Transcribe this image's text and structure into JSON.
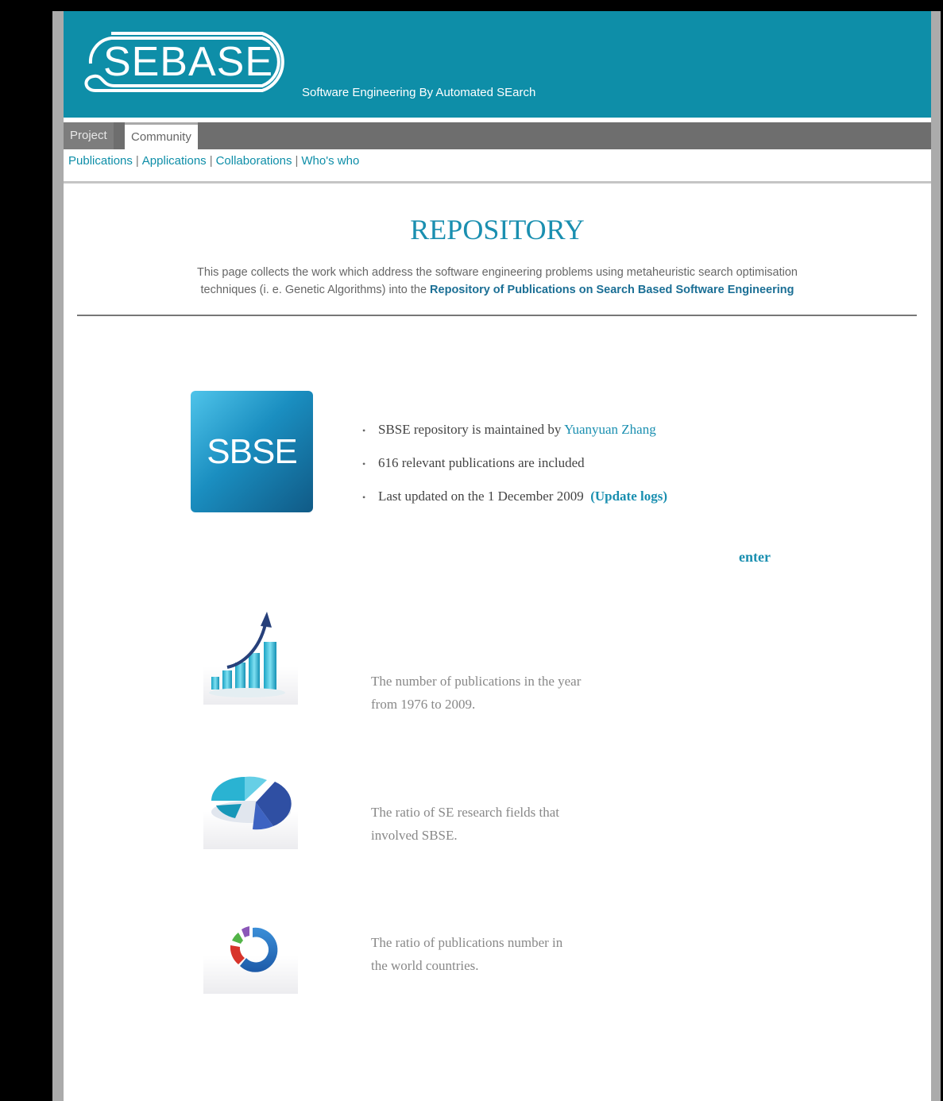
{
  "header": {
    "logo_text": "SEBASE",
    "tagline": "Software Engineering By Automated SEarch"
  },
  "tabs": [
    {
      "label": "Project"
    },
    {
      "label": "Community"
    }
  ],
  "subnav": {
    "items": [
      "Publications",
      "Applications",
      "Collaborations",
      "Who's who"
    ],
    "separator": "|"
  },
  "main": {
    "title": "REPOSITORY",
    "intro_line1": "This page collects the work which address the software engineering problems using metaheuristic search optimisation",
    "intro_line2_prefix": "techniques (i. e. Genetic Algorithms) into the",
    "intro_link": "Repository of Publications on Search Based Software Engineering"
  },
  "sbse": {
    "logo_text": "SBSE",
    "fact1_prefix": "SBSE repository is maintained by",
    "fact1_link": "Yuanyuan Zhang",
    "fact2": "616 relevant publications are included",
    "fact3_prefix": "Last updated on the 1 December 2009",
    "fact3_link": "(Update logs)",
    "enter": "enter"
  },
  "stats": [
    {
      "icon": "bar-chart-icon",
      "line1": "The number of publications in the year",
      "line2": "from 1976 to 2009."
    },
    {
      "icon": "pie-chart-icon",
      "line1": "The ratio of SE research fields that",
      "line2": "involved SBSE."
    },
    {
      "icon": "ring-chart-icon",
      "line1": "The ratio of publications number in",
      "line2": "the world countries."
    }
  ],
  "colors": {
    "brand": "#0e8ea8",
    "link": "#1a8fb0",
    "tabbar": "#6e6e6e"
  }
}
